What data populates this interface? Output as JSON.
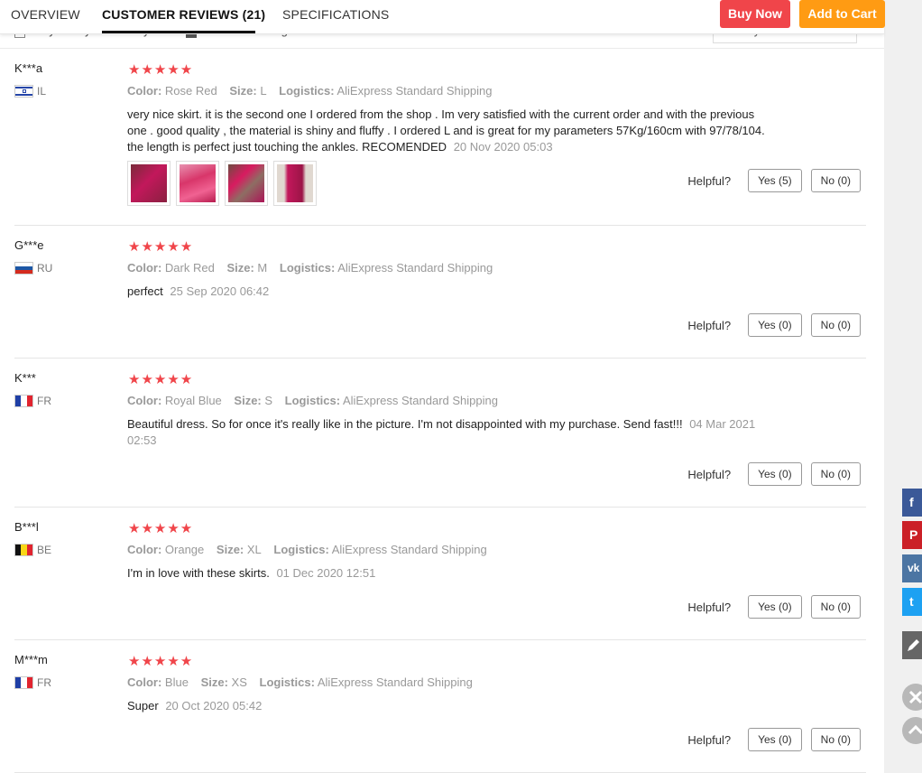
{
  "tabs": {
    "overview": "OVERVIEW",
    "reviews": "CUSTOMER REVIEWS (21)",
    "specs": "SPECIFICATIONS"
  },
  "actions": {
    "buy_now": "Buy Now",
    "add_to_cart": "Add to Cart"
  },
  "filters": {
    "only_country": "Only from your country",
    "translate": "Translate to English",
    "sort": "Sort by default"
  },
  "labels": {
    "color": "Color:",
    "size": "Size:",
    "logistics": "Logistics:",
    "helpful": "Helpful?"
  },
  "rating_glyphs": "★★★★★",
  "reviews": [
    {
      "user": "K***a",
      "country": "IL",
      "rating": 5,
      "color": "Rose Red",
      "size": "L",
      "logistics": "AliExpress Standard Shipping",
      "text": "very nice skirt. it is the second one I ordered from the shop . Im very satisfied with the current order and with the previous one . good quality , the material is shiny and fluffy . I ordered L and is great for my parameters 57Kg/160cm with 97/78/104. the length is perfect just touching the ankles. RECOMENDED",
      "date": "20 Nov 2020 05:03",
      "yes": "Yes (5)",
      "no": "No (0)"
    },
    {
      "user": "G***e",
      "country": "RU",
      "rating": 5,
      "color": "Dark Red",
      "size": "M",
      "logistics": "AliExpress Standard Shipping",
      "text": "perfect",
      "date": "25 Sep 2020 06:42",
      "yes": "Yes (0)",
      "no": "No (0)"
    },
    {
      "user": "K***",
      "country": "FR",
      "rating": 5,
      "color": "Royal Blue",
      "size": "S",
      "logistics": "AliExpress Standard Shipping",
      "text": "Beautiful dress. So for once it's really like in the picture. I'm not disappointed with my purchase. Send fast!!!",
      "date": "04 Mar 2021 02:53",
      "yes": "Yes (0)",
      "no": "No (0)"
    },
    {
      "user": "B***l",
      "country": "BE",
      "rating": 5,
      "color": "Orange",
      "size": "XL",
      "logistics": "AliExpress Standard Shipping",
      "text": "I'm in love with these skirts.",
      "date": "01 Dec 2020 12:51",
      "yes": "Yes (0)",
      "no": "No (0)"
    },
    {
      "user": "M***m",
      "country": "FR",
      "rating": 5,
      "color": "Blue",
      "size": "XS",
      "logistics": "AliExpress Standard Shipping",
      "text": "Super",
      "date": "20 Oct 2020 05:42",
      "yes": "Yes (0)",
      "no": "No (0)"
    }
  ],
  "share": {
    "facebook": "f",
    "pinterest": "P",
    "vk": "vk",
    "twitter": "t",
    "colors": {
      "facebook": "#3b5998",
      "pinterest": "#cb2027",
      "vk": "#4c75a3",
      "twitter": "#1da1f2",
      "edit": "#666666"
    }
  },
  "colors": {
    "star": "#f0454a",
    "buy_now": "#f0454a",
    "add_to_cart": "#ff9b13"
  }
}
